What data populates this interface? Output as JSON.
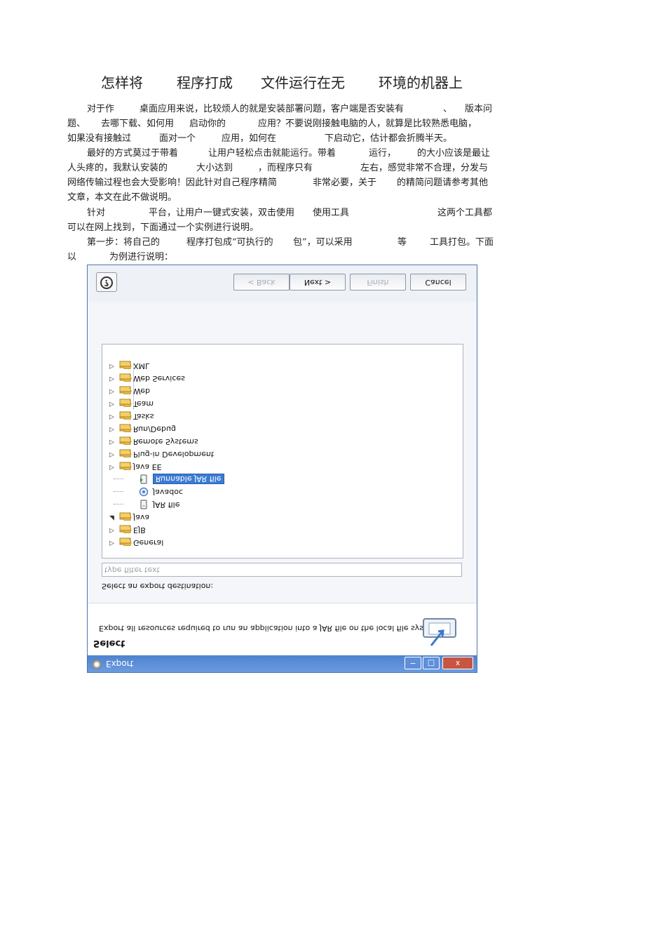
{
  "article": {
    "title": [
      "怎样将",
      "程序打成",
      "文件运行在无",
      "环境的机器上"
    ],
    "paragraphs": [
      [
        [
          "对于作",
          "桌面应用来说，比较烦人的就是安装部署问题，客户端是否安装有",
          "、",
          "版本问"
        ],
        [
          "题、",
          "去哪下载、如何用",
          "启动你的",
          "应用？不要说刚接触电脑的人，就算是比较熟悉电脑，"
        ],
        [
          "如果没有接触过",
          "面对一个",
          "应用，如何在",
          "下启动它，估计都会折腾半天。"
        ]
      ],
      [
        [
          "最好的方式莫过于带着",
          "让用户轻松点击就能运行。带着",
          "运行，",
          "的大小应该是最让"
        ],
        [
          "人头疼的，我默认安装的",
          "大小达到",
          "，而程序只有",
          "左右，感觉非常不合理，分发与"
        ],
        [
          "网络传输过程也会大受影响！因此针对自己程序精简",
          "非常必要，关于",
          "的精简问题请参考其他"
        ],
        [
          "文章，本文在此不做说明。"
        ]
      ],
      [
        [
          "针对",
          "平台，让用户一键式安装，双击使用",
          "使用工具",
          "这两个工具都"
        ],
        [
          "可以在网上找到，下面通过一个实例进行说明。"
        ]
      ],
      [
        [
          "第一步：将自己的",
          "程序打包成“可执行的",
          "包”，可以采用",
          "等",
          "工具打包。下面"
        ],
        [
          "以",
          "为例进行说明："
        ]
      ]
    ]
  },
  "dialog": {
    "window_title": "Export",
    "window_buttons": [
      "−",
      "□",
      "x"
    ],
    "banner_heading": "Select",
    "banner_description": "Export all resources required to run an application into a JAR file on the local file system.",
    "destination_label": "Select an export destination:",
    "filter_placeholder": "type filter text",
    "tree": [
      {
        "label": "General",
        "expanded": false,
        "icon": "folder-icon"
      },
      {
        "label": "EJB",
        "expanded": false,
        "icon": "folder-icon"
      },
      {
        "label": "Java",
        "expanded": true,
        "icon": "folder-icon"
      },
      {
        "label": "JAR file",
        "child": true,
        "icon": "jar-file-icon"
      },
      {
        "label": "Javadoc",
        "child": true,
        "icon": "javadoc-icon"
      },
      {
        "label": "Runnable JAR file",
        "child": true,
        "selected": true,
        "icon": "runnable-jar-icon"
      },
      {
        "label": "Java EE",
        "expanded": false,
        "icon": "folder-icon"
      },
      {
        "label": "Plug-in Development",
        "expanded": false,
        "icon": "folder-icon"
      },
      {
        "label": "Remote Systems",
        "expanded": false,
        "icon": "folder-icon"
      },
      {
        "label": "Run/Debug",
        "expanded": false,
        "icon": "folder-icon"
      },
      {
        "label": "Tasks",
        "expanded": false,
        "icon": "folder-icon"
      },
      {
        "label": "Team",
        "expanded": false,
        "icon": "folder-icon"
      },
      {
        "label": "Web",
        "expanded": false,
        "icon": "folder-icon"
      },
      {
        "label": "Web Services",
        "expanded": false,
        "icon": "folder-icon"
      },
      {
        "label": "XML",
        "expanded": false,
        "icon": "folder-icon"
      }
    ],
    "buttons": {
      "help": "?",
      "back": "< Back",
      "next": "Next >",
      "finish": "Finish",
      "cancel": "Cancel"
    },
    "colors": {
      "titlebar": "#5b8ed9",
      "selection": "#3b7bd4",
      "folder": "#e7b944"
    }
  }
}
